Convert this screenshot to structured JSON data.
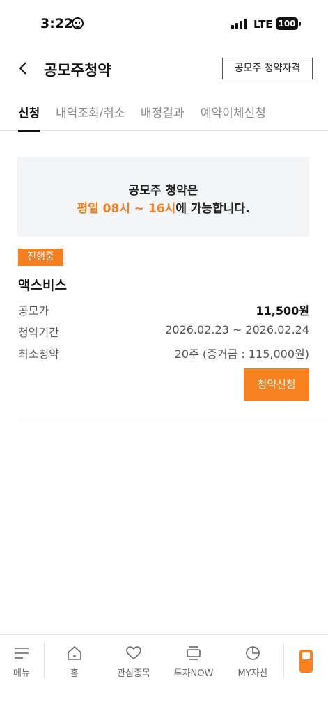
{
  "status_bar": {
    "time": "3:22",
    "network": "LTE",
    "battery": "100"
  },
  "header": {
    "title": "공모주청약",
    "qual_button": "공모주 청약자격"
  },
  "tabs": [
    {
      "label": "신청",
      "active": true
    },
    {
      "label": "내역조회/취소",
      "active": false
    },
    {
      "label": "배정결과",
      "active": false
    },
    {
      "label": "예약이체신청",
      "active": false
    }
  ],
  "notice": {
    "line1": "공모주 청약은",
    "line2_highlight": "평일 08시 ~ 16시",
    "line2_rest": "에 가능합니다."
  },
  "offering": {
    "status": "진행중",
    "name": "액스비스",
    "rows": [
      {
        "label": "공모가",
        "value": "11,500원"
      },
      {
        "label": "청약기간",
        "value": "2026.02.23 ~ 2026.02.24"
      },
      {
        "label": "최소청약",
        "value": "20주 (증거금 : 115,000원)"
      }
    ],
    "apply_button": "청약신청"
  },
  "bottom_nav": [
    {
      "label": "메뉴",
      "icon": "menu-icon"
    },
    {
      "label": "홈",
      "icon": "home-icon"
    },
    {
      "label": "관심종목",
      "icon": "heart-icon"
    },
    {
      "label": "투자NOW",
      "icon": "layers-icon"
    },
    {
      "label": "MY자산",
      "icon": "pie-chart-icon"
    }
  ],
  "colors": {
    "accent": "#f57f20"
  }
}
